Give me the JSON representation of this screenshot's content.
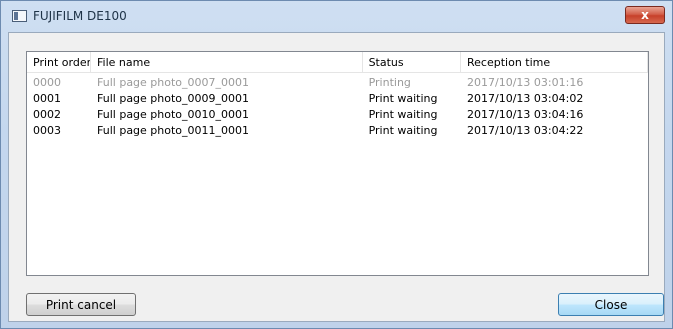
{
  "window": {
    "title": "FUJIFILM DE100"
  },
  "list": {
    "columns": [
      "Print order",
      "File name",
      "Status",
      "Reception time"
    ],
    "rows": [
      {
        "order": "0000",
        "file": "Full page photo_0007_0001",
        "status": "Printing",
        "time": "2017/10/13 03:01:16"
      },
      {
        "order": "0001",
        "file": "Full page photo_0009_0001",
        "status": "Print waiting",
        "time": "2017/10/13 03:04:02"
      },
      {
        "order": "0002",
        "file": "Full page photo_0010_0001",
        "status": "Print waiting",
        "time": "2017/10/13 03:04:16"
      },
      {
        "order": "0003",
        "file": "Full page photo_0011_0001",
        "status": "Print waiting",
        "time": "2017/10/13 03:04:22"
      }
    ]
  },
  "buttons": {
    "print_cancel": "Print cancel",
    "close": "Close",
    "title_close": "x"
  }
}
